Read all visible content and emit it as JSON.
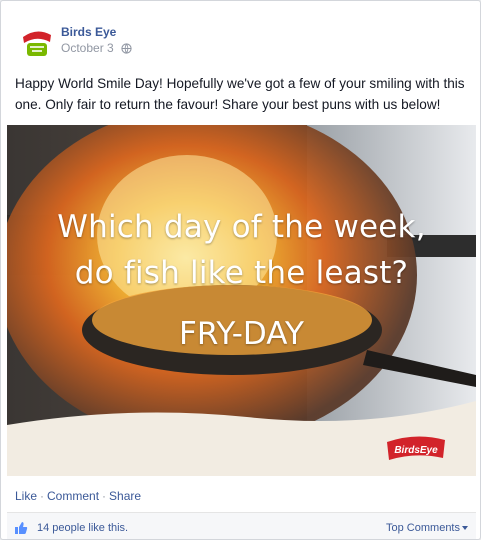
{
  "post": {
    "author": "Birds Eye",
    "date": "October 3",
    "privacy_icon": "globe-icon",
    "message": "Happy World Smile Day! Hopefully we've got a few of your smiling with this one. Only fair to return the favour! Share your best puns with us below!"
  },
  "image": {
    "line1": "Which day of the week,",
    "line2": "do fish like the least?",
    "punchline": "FRY-DAY",
    "brand_logo_text": "BirdsEye"
  },
  "actions": {
    "like": "Like",
    "comment": "Comment",
    "share": "Share",
    "separator": "·"
  },
  "likes": {
    "text": "14 people like this.",
    "top_comments": "Top Comments"
  },
  "colors": {
    "link": "#3b5998",
    "brand_red": "#d2232a",
    "brand_green": "#7ab800"
  }
}
